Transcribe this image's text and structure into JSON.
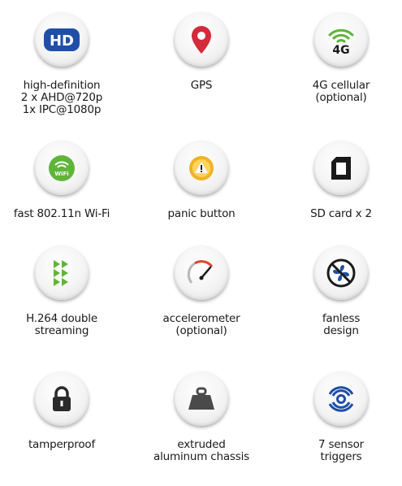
{
  "features": [
    {
      "icon": "hd-icon",
      "lines": [
        "high-definition",
        "2 x AHD@720p",
        "1x IPC@1080p"
      ],
      "icon_text": "HD",
      "color": "#1f4fa8"
    },
    {
      "icon": "location-pin-icon",
      "lines": [
        "GPS"
      ],
      "color": "#d42a3a"
    },
    {
      "icon": "cellular-4g-icon",
      "lines": [
        "4G cellular",
        "(optional)"
      ],
      "icon_text": "4G",
      "color": "#5fb53a"
    },
    {
      "icon": "wifi-icon",
      "lines": [
        "fast 802.11n Wi-Fi"
      ],
      "icon_text": "WiFi",
      "color": "#5fb53a"
    },
    {
      "icon": "panic-alert-icon",
      "lines": [
        "panic button"
      ],
      "color": "#f0b323"
    },
    {
      "icon": "sd-card-icon",
      "lines": [
        "SD card x 2"
      ],
      "color": "#1a1a1a"
    },
    {
      "icon": "streaming-icon",
      "lines": [
        "H.264 double",
        "streaming"
      ],
      "color": "#5fb53a"
    },
    {
      "icon": "speedometer-icon",
      "lines": [
        "accelerometer",
        "(optional)"
      ],
      "color": "#e0462a"
    },
    {
      "icon": "fan-icon",
      "lines": [
        "fanless",
        "design"
      ],
      "color": "#1f4fa8"
    },
    {
      "icon": "padlock-icon",
      "lines": [
        "tamperproof"
      ],
      "color": "#2a2a2a"
    },
    {
      "icon": "weight-icon",
      "lines": [
        "extruded",
        "aluminum chassis"
      ],
      "color": "#4a4a4a"
    },
    {
      "icon": "sensor-icon",
      "lines": [
        "7 sensor",
        "triggers"
      ],
      "color": "#1f4fa8"
    }
  ]
}
